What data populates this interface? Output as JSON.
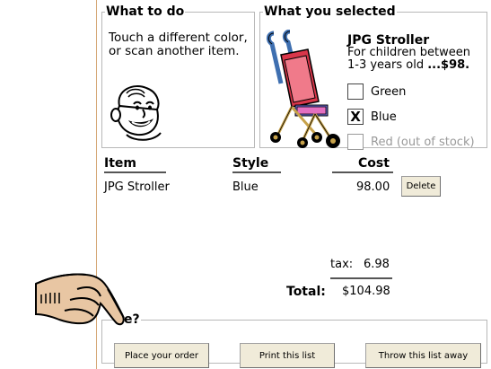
{
  "instructions": {
    "title": "What to do",
    "text": "Touch a different color, or scan another item."
  },
  "selection": {
    "title": "What you selected",
    "product_name": "JPG Stroller",
    "description_line1": "For children between",
    "description_line2": "1-3 years old",
    "price": "...$98.",
    "options": [
      {
        "label": "Green",
        "mark": "",
        "disabled": false
      },
      {
        "label": "Blue",
        "mark": "X",
        "disabled": false
      },
      {
        "label": "Red (out of stock)",
        "mark": "",
        "disabled": true
      }
    ]
  },
  "order": {
    "headers": {
      "item": "Item",
      "style": "Style",
      "cost": "Cost"
    },
    "rows": [
      {
        "item": "JPG Stroller",
        "style": "Blue",
        "cost": "98.00",
        "delete_label": "Delete"
      }
    ],
    "tax_label": "tax:",
    "tax": "6.98",
    "total_label": "Total:",
    "total": "$104.98"
  },
  "actions": {
    "legend": "e?",
    "place_order": "Place your order",
    "print_list": "Print this list",
    "throw_away": "Throw this list away"
  },
  "colors": {
    "button_bg": "#f0ebd9",
    "frame_line": "#d6a878",
    "stroller_frame": "#3e6fb0",
    "stroller_seat": "#d9364a"
  }
}
